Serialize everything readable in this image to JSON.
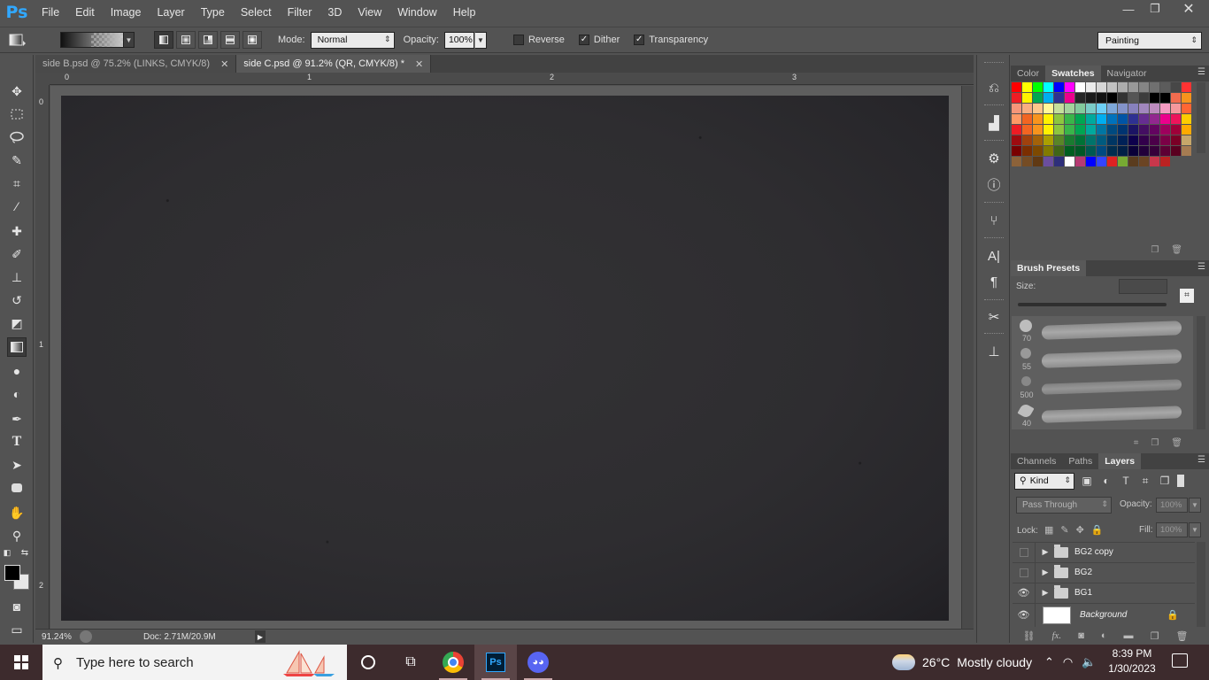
{
  "app": {
    "logo": "Ps"
  },
  "menu": [
    "File",
    "Edit",
    "Image",
    "Layer",
    "Type",
    "Select",
    "Filter",
    "3D",
    "View",
    "Window",
    "Help"
  ],
  "window_controls": {
    "minimize": "—",
    "restore": "❐",
    "close": "✕"
  },
  "options": {
    "mode_label": "Mode:",
    "mode_value": "Normal",
    "opacity_label": "Opacity:",
    "opacity_value": "100%",
    "reverse_label": "Reverse",
    "reverse_checked": false,
    "dither_label": "Dither",
    "dither_checked": true,
    "transparency_label": "Transparency",
    "transparency_checked": true,
    "workspace": "Painting"
  },
  "doc_tabs": [
    {
      "label": "side B.psd @ 75.2% (LINKS, CMYK/8)",
      "close": "✕"
    },
    {
      "label": "side C.psd @ 91.2% (QR, CMYK/8) *",
      "close": "✕"
    }
  ],
  "ruler": {
    "top": [
      "0",
      "1",
      "2",
      "3"
    ],
    "left": [
      "0",
      "1",
      "2"
    ]
  },
  "status": {
    "zoom": "91.24%",
    "doc": "Doc: 2.71M/20.9M",
    "arrow": "▶"
  },
  "panels": {
    "top_tabs": [
      "Color",
      "Swatches",
      "Navigator"
    ],
    "brush_presets": {
      "tab": "Brush Presets",
      "size_label": "Size:",
      "sizes": [
        "70",
        "55",
        "500",
        "40"
      ]
    },
    "layers_tabs": [
      "Channels",
      "Paths",
      "Layers"
    ],
    "kind_filter": "Kind",
    "blend_mode": "Pass Through",
    "opacity_label": "Opacity:",
    "opacity_value": "100%",
    "lock_label": "Lock:",
    "fill_label": "Fill:",
    "fill_value": "100%",
    "layers": [
      {
        "name": "BG2 copy",
        "visible": false,
        "group": true
      },
      {
        "name": "BG2",
        "visible": false,
        "group": true
      },
      {
        "name": "BG1",
        "visible": true,
        "group": true
      },
      {
        "name": "Background",
        "visible": true,
        "group": false,
        "locked": true
      }
    ]
  },
  "swatch_colors": [
    "#ff0000",
    "#ffff00",
    "#00ff00",
    "#00ffff",
    "#0000ff",
    "#ff00ff",
    "#ffffff",
    "#ebebeb",
    "#d6d6d6",
    "#c2c2c2",
    "#adadad",
    "#999999",
    "#858585",
    "#707070",
    "#5c5c5c",
    "#474747",
    "#ff3333",
    "#ee1d24",
    "#fff200",
    "#00a651",
    "#00aeef",
    "#2e3192",
    "#ec008c",
    "#262626",
    "#1a1a1a",
    "#111111",
    "#000000",
    "#333333",
    "#555555",
    "#3d3d3d",
    "#000000",
    "#000000",
    "#f26c4f",
    "#f7941d",
    "#f69679",
    "#f9ad81",
    "#fdc68a",
    "#fff799",
    "#c4df9b",
    "#a3d39c",
    "#82ca9c",
    "#7accc8",
    "#6dcff6",
    "#7da7d9",
    "#8393ca",
    "#8781bd",
    "#a187be",
    "#bd8cbf",
    "#f49ac1",
    "#f5989d",
    "#ff6633",
    "#ff9966",
    "#f26522",
    "#f7941d",
    "#fff200",
    "#8dc63f",
    "#39b54a",
    "#00a651",
    "#00a99d",
    "#00aeef",
    "#0072bc",
    "#0054a6",
    "#2e3192",
    "#662d91",
    "#92278f",
    "#ec008c",
    "#ed145b",
    "#ffcc00",
    "#ed1c24",
    "#f26522",
    "#f7941d",
    "#fff200",
    "#8dc63f",
    "#39b54a",
    "#00a651",
    "#00a99d",
    "#0076a3",
    "#004a80",
    "#003471",
    "#1b1464",
    "#440e62",
    "#630460",
    "#9e005d",
    "#9e0039",
    "#ffaa00",
    "#9e0b0f",
    "#a0410d",
    "#a36209",
    "#aba000",
    "#598527",
    "#1a7b30",
    "#007236",
    "#00746b",
    "#005b7f",
    "#003663",
    "#002157",
    "#0d004c",
    "#32004b",
    "#4b0049",
    "#7b0046",
    "#7a0026",
    "#c7a76a",
    "#790000",
    "#7b2e00",
    "#7d4900",
    "#827b00",
    "#406618",
    "#005e20",
    "#005826",
    "#005952",
    "#004a80",
    "#002d4f",
    "#001f46",
    "#0a0038",
    "#22003a",
    "#36003a",
    "#5d0034",
    "#5a0020",
    "#a67c52",
    "#8c6239",
    "#754c24",
    "#603913",
    "#6b4e9e",
    "#2e2f7a",
    "#ffffff",
    "#b63a72",
    "#0000ff",
    "#3344ff",
    "#d22",
    "#7a3",
    "#5a3c1e",
    "#6b4423",
    "#c8374b",
    "#b22",
    "#0000"
  ],
  "taskbar": {
    "search_placeholder": "Type here to search",
    "weather_temp": "26°C",
    "weather_text": "Mostly cloudy",
    "time": "8:39 PM",
    "date": "1/30/2023"
  }
}
